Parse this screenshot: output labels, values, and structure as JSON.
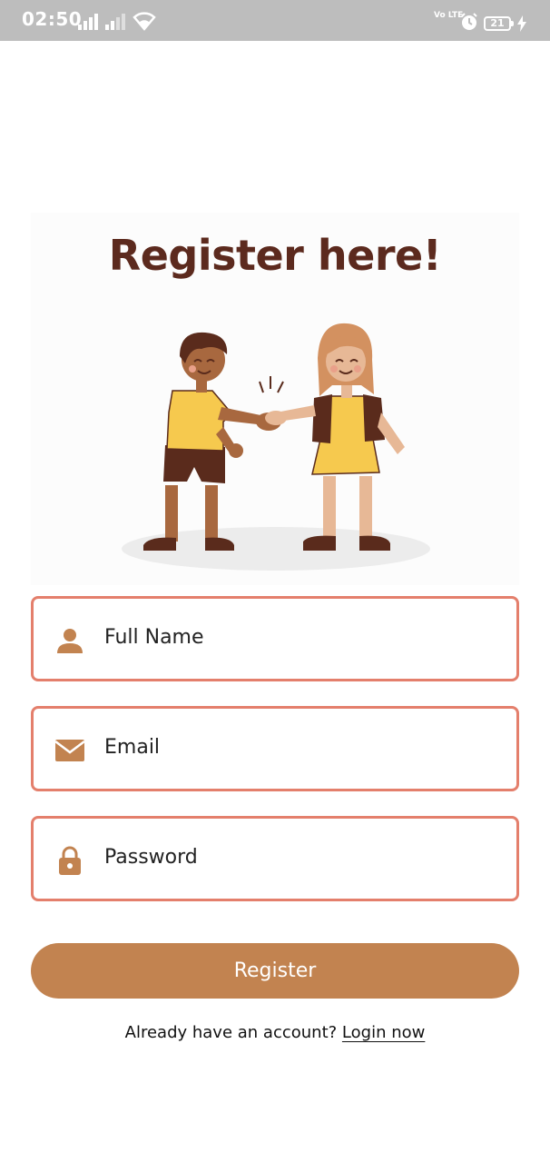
{
  "status_bar": {
    "time": "02:50",
    "network_label": "Vo LTE",
    "battery": "21",
    "icons": [
      "signal-icon",
      "signal-icon",
      "wifi-icon",
      "volte-icon",
      "alarm-icon",
      "battery-icon",
      "charging-icon"
    ]
  },
  "hero": {
    "title": "Register here!",
    "illustration": "two-people-handshake"
  },
  "form": {
    "full_name_placeholder": "Full Name",
    "email_placeholder": "Email",
    "password_placeholder": "Password",
    "register_label": "Register"
  },
  "footer": {
    "prompt": "Already have an account?",
    "login_link": "Login now"
  },
  "colors": {
    "field_border": "#e47f6c",
    "accent_brown": "#c28350",
    "title_brown": "#5c2a1e"
  }
}
